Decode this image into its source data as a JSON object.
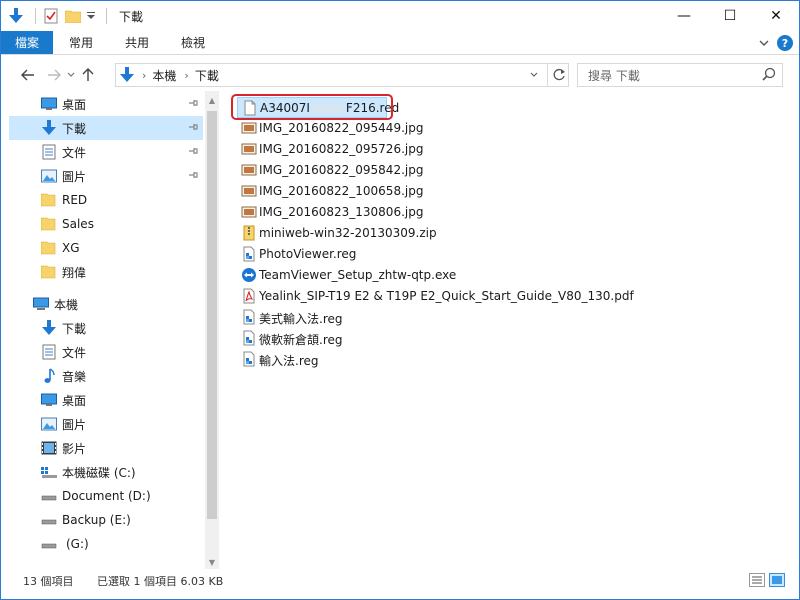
{
  "window": {
    "title": "下載",
    "controls": {
      "minimize": "—",
      "maximize": "☐",
      "close": "✕"
    }
  },
  "ribbon": {
    "tabs": [
      "檔案",
      "常用",
      "共用",
      "檢視"
    ],
    "help": "?"
  },
  "address": {
    "path": [
      "本機",
      "下載"
    ],
    "search_placeholder": "搜尋 下載"
  },
  "nav": {
    "quick_access": [
      {
        "label": "桌面",
        "icon": "desktop-icon",
        "pinned": true
      },
      {
        "label": "下載",
        "icon": "download-icon",
        "pinned": true,
        "selected": true
      },
      {
        "label": "文件",
        "icon": "document-icon",
        "pinned": true
      },
      {
        "label": "圖片",
        "icon": "pictures-icon",
        "pinned": true
      },
      {
        "label": "RED",
        "icon": "folder-icon"
      },
      {
        "label": "Sales",
        "icon": "folder-icon"
      },
      {
        "label": "XG",
        "icon": "folder-icon"
      },
      {
        "label": "翔偉",
        "icon": "folder-icon"
      }
    ],
    "this_pc": {
      "label": "本機",
      "icon": "computer-icon"
    },
    "pc_items": [
      {
        "label": "下載",
        "icon": "download-icon"
      },
      {
        "label": "文件",
        "icon": "document-icon"
      },
      {
        "label": "音樂",
        "icon": "music-icon"
      },
      {
        "label": "桌面",
        "icon": "desktop-icon"
      },
      {
        "label": "圖片",
        "icon": "pictures-icon"
      },
      {
        "label": "影片",
        "icon": "video-icon"
      },
      {
        "label": "本機磁碟 (C:)",
        "icon": "system-drive-icon"
      },
      {
        "label": "Document (D:)",
        "icon": "drive-icon"
      },
      {
        "label": "Backup (E:)",
        "icon": "drive-icon"
      },
      {
        "label": "(G:)",
        "icon": "drive-icon"
      }
    ]
  },
  "files": [
    {
      "name_start": "A34007I",
      "name_end": "F216.red",
      "icon": "blank-file-icon",
      "selected": true
    },
    {
      "name": "IMG_20160822_095449.jpg",
      "icon": "image-file-icon"
    },
    {
      "name": "IMG_20160822_095726.jpg",
      "icon": "image-file-icon"
    },
    {
      "name": "IMG_20160822_095842.jpg",
      "icon": "image-file-icon"
    },
    {
      "name": "IMG_20160822_100658.jpg",
      "icon": "image-file-icon"
    },
    {
      "name": "IMG_20160823_130806.jpg",
      "icon": "image-file-icon"
    },
    {
      "name": "miniweb-win32-20130309.zip",
      "icon": "zip-file-icon"
    },
    {
      "name": "PhotoViewer.reg",
      "icon": "reg-file-icon"
    },
    {
      "name": "TeamViewer_Setup_zhtw-qtp.exe",
      "icon": "teamviewer-icon"
    },
    {
      "name": "Yealink_SIP-T19 E2 & T19P E2_Quick_Start_Guide_V80_130.pdf",
      "icon": "pdf-file-icon"
    },
    {
      "name": "美式輸入法.reg",
      "icon": "reg-file-icon"
    },
    {
      "name": "微軟新倉頡.reg",
      "icon": "reg-file-icon"
    },
    {
      "name": "輸入法.reg",
      "icon": "reg-file-icon"
    }
  ],
  "status": {
    "count": "13 個項目",
    "selection": "已選取 1 個項目 6.03 KB"
  },
  "colors": {
    "accent": "#1979ca",
    "selection": "#cce8ff",
    "highlight_box": "#d8262b"
  }
}
